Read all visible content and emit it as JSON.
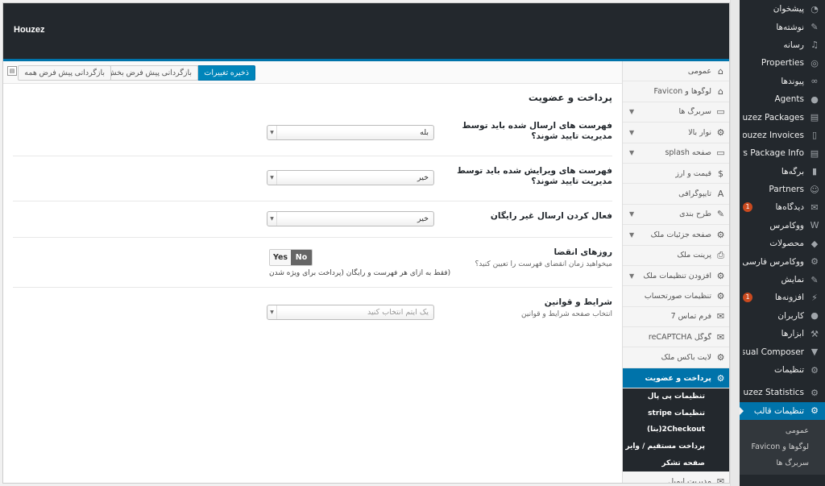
{
  "header": {
    "brand": "Houzez"
  },
  "toolbar": {
    "save_label": "ذخیره تغییرات",
    "reset_section_label": "بازگردانی پیش فرض بخش",
    "reset_all_label": "بازگردانی پیش فرض همه"
  },
  "section": {
    "title": "پرداخت و عضویت"
  },
  "fields": {
    "approve_new": {
      "label": "فهرست های ارسال شده باید توسط مدیریت تایید شوند؟",
      "value": "بله"
    },
    "approve_edit": {
      "label": "فهرست های ویرایش شده باید توسط مدیریت تایید شوند؟",
      "value": "خیر"
    },
    "free_submit": {
      "label": "فعال کردن ارسال غیر رایگان",
      "value": "خیر"
    },
    "expiry": {
      "label": "روزهای انقضا",
      "sub": "میخواهید زمان انقضای فهرست را تعیین کنید؟",
      "yes": "Yes",
      "no": "No",
      "selected": "No",
      "desc": "(فقط به ازای هر فهرست و رایگان (پرداخت برای ویژه شدن"
    },
    "terms": {
      "label": "شرایط و قوانین",
      "sub": "انتخاب صفحه شرایط و قوانین",
      "placeholder": "یک ایتم انتخاب کنید"
    }
  },
  "redux_menu": {
    "items": [
      {
        "label": "عمومی",
        "icon": "home-icon"
      },
      {
        "label": "لوگوها و Favicon",
        "icon": "home-icon"
      },
      {
        "label": "سربرگ ها",
        "icon": "monitor-icon",
        "chevron": true
      },
      {
        "label": "نوار بالا",
        "icon": "gear-icon",
        "chevron": true
      },
      {
        "label": "صفحه splash",
        "icon": "monitor-icon",
        "chevron": true
      },
      {
        "label": "قیمت و ارز",
        "icon": "dollar-icon"
      },
      {
        "label": "تایپوگرافی",
        "icon": "font-icon"
      },
      {
        "label": "طرح بندی",
        "icon": "pencil-icon",
        "chevron": true
      },
      {
        "label": "صفحه جزئیات ملک",
        "icon": "gear-icon",
        "chevron": true
      },
      {
        "label": "پرینت ملک",
        "icon": "print-icon"
      },
      {
        "label": "افزودن تنظیمات ملک",
        "icon": "gear-icon",
        "chevron": true
      },
      {
        "label": "تنظیمات صورتحساب",
        "icon": "gear-icon"
      },
      {
        "label": "فرم تماس 7",
        "icon": "mail-icon"
      },
      {
        "label": "گوگل reCAPTCHA",
        "icon": "mail-icon"
      },
      {
        "label": "لایت باکس ملک",
        "icon": "gear-icon"
      }
    ],
    "active": {
      "label": "پرداخت و عضویت",
      "icon": "gear-icon"
    },
    "subitems": [
      "تنظیمات پی پال",
      "تنظیمات stripe",
      "2Checkout(بتا)",
      "پرداخت مستقیم / وایر",
      "صفحه تشکر"
    ],
    "last": {
      "label": "مدیریت ایمیل",
      "icon": "mail-icon"
    }
  },
  "wp_menu": {
    "items": [
      {
        "label": "پیشخوان",
        "icon": "dashboard-icon"
      },
      {
        "label": "نوشته‌ها",
        "icon": "pin-icon"
      },
      {
        "label": "رسانه",
        "icon": "media-icon"
      },
      {
        "label": "Properties",
        "icon": "location-icon"
      },
      {
        "label": "پیوندها",
        "icon": "link-icon"
      },
      {
        "label": "Agents",
        "icon": "user-icon"
      },
      {
        "label": "Houzez Packages",
        "icon": "card-icon"
      },
      {
        "label": "Houzez Invoices",
        "icon": "doc-icon"
      },
      {
        "label": "Users Package Info",
        "icon": "card-icon"
      },
      {
        "label": "برگه‌ها",
        "icon": "pages-icon"
      },
      {
        "label": "Partners",
        "icon": "partner-icon"
      },
      {
        "label": "دیدگاه‌ها",
        "icon": "comment-icon",
        "badge": "1"
      },
      {
        "label": "ووکامرس",
        "icon": "woo-icon"
      },
      {
        "label": "محصولات",
        "icon": "box-icon"
      },
      {
        "label": "ووکامرس فارسی",
        "icon": "gear-icon"
      },
      {
        "label": "نمایش",
        "icon": "brush-icon"
      },
      {
        "label": "افزونه‌ها",
        "icon": "plugin-icon",
        "badge": "1"
      },
      {
        "label": "کاربران",
        "icon": "user-icon"
      },
      {
        "label": "ابزارها",
        "icon": "wrench-icon"
      },
      {
        "label": "Visual Composer",
        "icon": "vc-icon"
      },
      {
        "label": "تنظیمات",
        "icon": "settings-icon"
      }
    ],
    "stats": {
      "label": "Houzez Statistics",
      "icon": "gear-icon"
    },
    "active": {
      "label": "تنظیمات قالب",
      "icon": "gear-icon"
    },
    "subitems": [
      "عمومی",
      "لوگوها و Favicon",
      "سربرگ ها"
    ]
  }
}
